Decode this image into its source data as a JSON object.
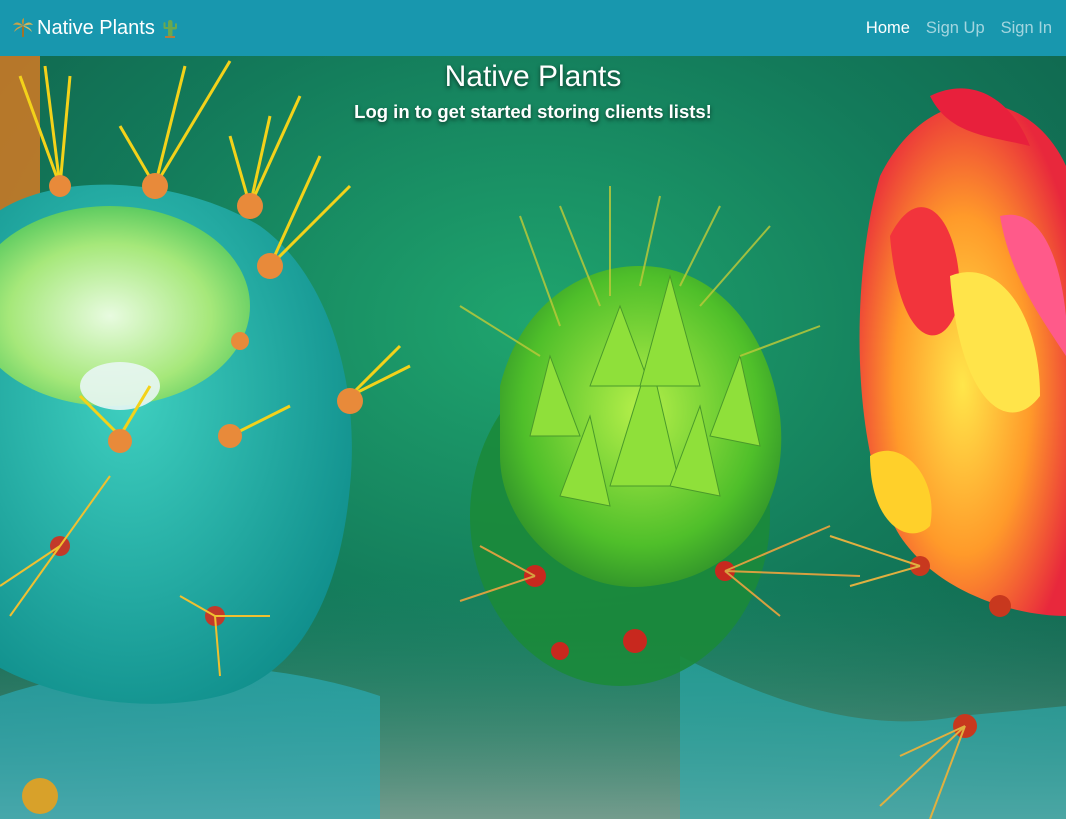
{
  "navbar": {
    "brand_label": "Native Plants",
    "brand_icon_left": "palm-leaf-icon",
    "brand_icon_right": "cactus-icon",
    "links": [
      {
        "label": "Home",
        "active": true
      },
      {
        "label": "Sign Up",
        "active": false
      },
      {
        "label": "Sign In",
        "active": false
      }
    ],
    "background_color": "#1897ae"
  },
  "hero": {
    "title": "Native Plants",
    "subtitle": "Log in to get started storing clients lists!",
    "background_image": "prickly-pear-cactus-photo"
  }
}
